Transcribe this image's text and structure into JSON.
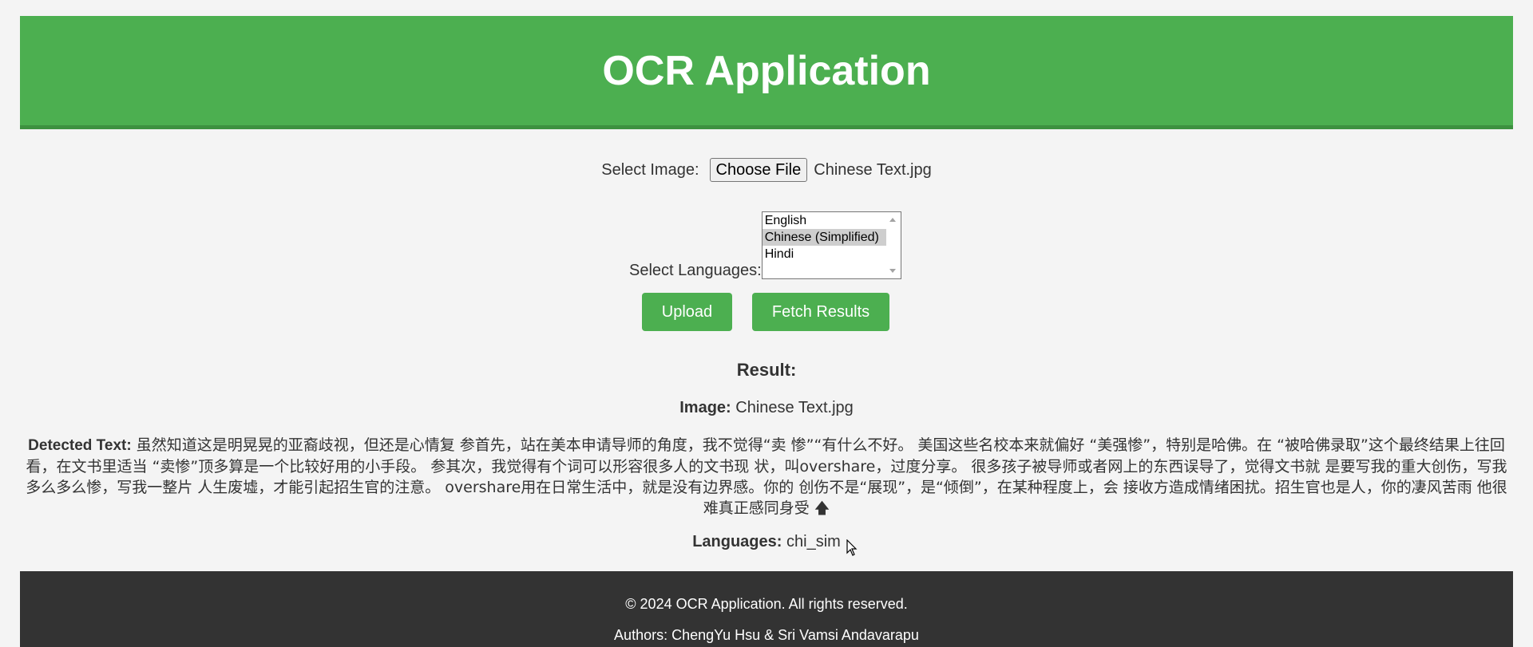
{
  "header": {
    "title": "OCR Application"
  },
  "file_select": {
    "label": "Select Image:",
    "button_label": "Choose File",
    "file_name": "Chinese Text.jpg"
  },
  "languages_select": {
    "label": "Select Languages:",
    "options": [
      "English",
      "Chinese (Simplified)",
      "Hindi"
    ],
    "selected": "Chinese (Simplified)"
  },
  "actions": {
    "upload_label": "Upload",
    "fetch_label": "Fetch Results"
  },
  "result": {
    "title": "Result:",
    "image_label": "Image:",
    "image_value": "Chinese Text.jpg",
    "detected_label": "Detected Text:",
    "detected_value": "虽然知道这是明晃晃的亚裔歧视，但还是心情复 参首先，站在美本申请导师的角度，我不觉得“卖 惨”“有什么不好。 美国这些名校本来就偏好 “美强惨”，特别是哈佛。在 “被哈佛录取”这个最终结果上往回看，在文书里适当 “卖惨”顶多算是一个比较好用的小手段。 参其次，我觉得有个词可以形容很多人的文书现 状，叫overshare，过度分享。 很多孩子被导师或者网上的东西误导了，觉得文书就 是要写我的重大创伤，写我多么多么惨，写我一整片 人生废墟，才能引起招生官的注意。 overshare用在日常生活中，就是没有边界感。你的 创伤不是“展现”，是“倾倒”，在某种程度上，会 接收方造成情绪困扰。招生官也是人，你的凄风苦雨 他很难真正感同身受",
    "detected_symbol": "🡅",
    "languages_label": "Languages:",
    "languages_value": "chi_sim"
  },
  "footer": {
    "copyright": "© 2024 OCR Application. All rights reserved.",
    "authors": "Authors: ChengYu Hsu & Sri Vamsi Andavarapu"
  },
  "colors": {
    "accent": "#4caf50",
    "footer_bg": "#333333",
    "page_bg": "#f4f4f4"
  }
}
